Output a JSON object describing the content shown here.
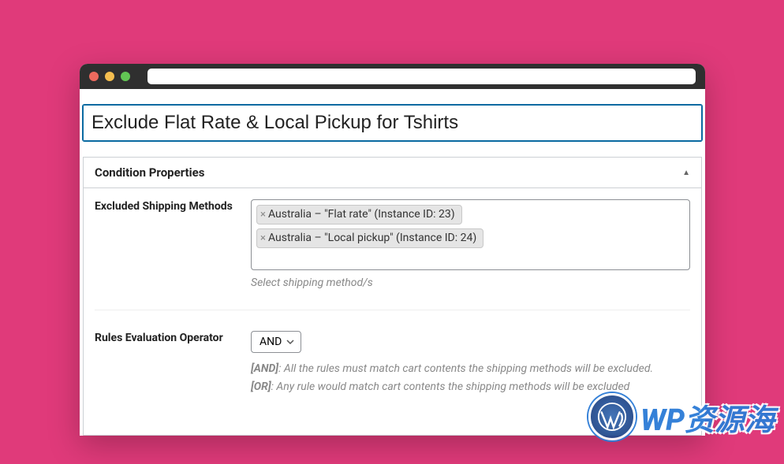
{
  "title_input": "Exclude Flat Rate & Local Pickup for Tshirts",
  "panel": {
    "header": "Condition Properties"
  },
  "excluded_methods": {
    "label": "Excluded Shipping Methods",
    "tags": [
      "Australia – \"Flat rate\" (Instance ID: 23)",
      "Australia – \"Local pickup\" (Instance ID: 24)"
    ],
    "help": "Select shipping method/s"
  },
  "rules_operator": {
    "label": "Rules Evaluation Operator",
    "value": "AND",
    "and_label": "[AND]",
    "and_desc": ": All the rules must match cart contents the shipping methods will be excluded.",
    "or_label": "[OR]",
    "or_desc": ": Any rule would match cart contents the shipping methods will be excluded"
  },
  "watermark": "WP资源海"
}
